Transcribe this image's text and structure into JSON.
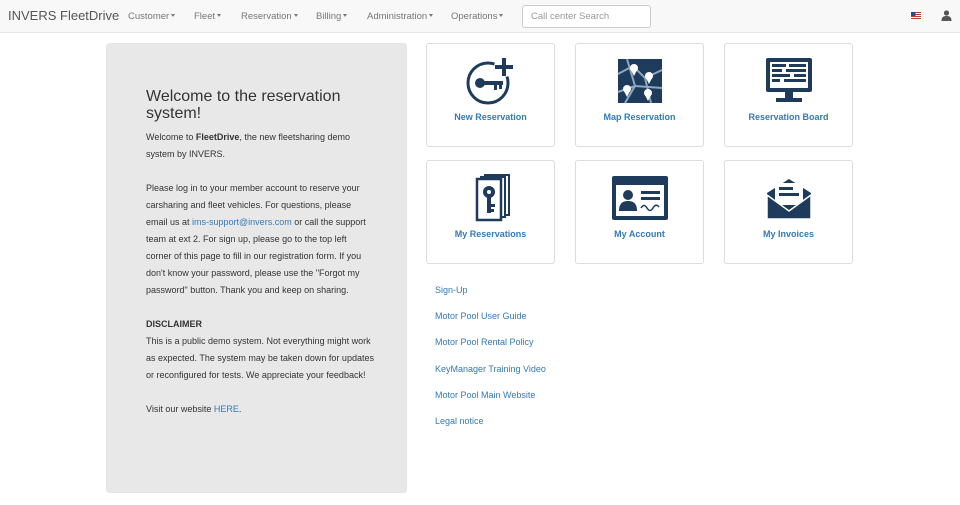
{
  "app": {
    "brand": "INVERS FleetDrive"
  },
  "nav": {
    "items": [
      {
        "label": "Customer"
      },
      {
        "label": "Fleet"
      },
      {
        "label": "Reservation"
      },
      {
        "label": "Billing"
      },
      {
        "label": "Administration"
      },
      {
        "label": "Operations"
      }
    ],
    "search": {
      "placeholder": "Call center Search",
      "value": ""
    }
  },
  "welcome": {
    "title": "Welcome to the reservation system!",
    "intro_pre": "Welcome to ",
    "intro_bold": "FleetDrive",
    "intro_post": ", the new fleetsharing demo system by INVERS.",
    "login_pre": "Please log in to your member account to reserve your carsharing and fleet vehicles. For questions, please email us at ",
    "email": "ims-support@invers.com",
    "login_post": " or call the support team at ext 2. For sign up, please go to the top left corner of this page to fill in our registration form. If you don't know your password, please use the \"Forgot my password\" button. Thank you and keep on sharing.",
    "disclaimer_heading": "DISCLAIMER",
    "disclaimer_text": "This is a public demo system. Not everything might work as expected. The system may be taken down for updates or reconfigured for tests. We appreciate your feedback!",
    "visit_pre": "Visit our website ",
    "visit_link": "HERE",
    "visit_post": "."
  },
  "tiles": [
    {
      "label": "New Reservation",
      "icon": "key-plus-icon"
    },
    {
      "label": "Map Reservation",
      "icon": "map-pins-icon"
    },
    {
      "label": "Reservation Board",
      "icon": "monitor-board-icon"
    },
    {
      "label": "My Reservations",
      "icon": "key-cards-icon"
    },
    {
      "label": "My Account",
      "icon": "id-card-icon"
    },
    {
      "label": "My Invoices",
      "icon": "envelope-icon"
    }
  ],
  "links": [
    {
      "label": "Sign-Up"
    },
    {
      "label": "Motor Pool User Guide"
    },
    {
      "label": "Motor Pool Rental Policy"
    },
    {
      "label": "KeyManager Training Video"
    },
    {
      "label": "Motor Pool Main Website"
    },
    {
      "label": "Legal notice"
    }
  ],
  "colors": {
    "accent": "#337ab7",
    "icon": "#1f3b5c",
    "panel": "#e8e8e8"
  }
}
